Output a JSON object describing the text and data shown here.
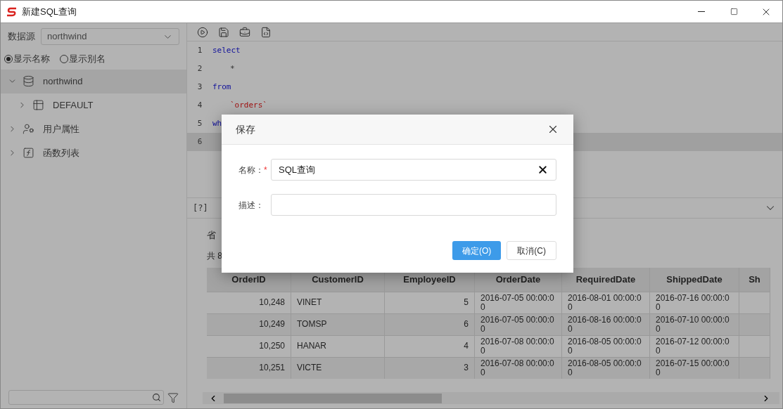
{
  "window": {
    "title": "新建SQL查询"
  },
  "sidebar": {
    "datasource_label": "数据源",
    "datasource_value": "northwind",
    "display_options": [
      {
        "label": "显示名称",
        "selected": true
      },
      {
        "label": "显示别名",
        "selected": false
      }
    ],
    "tree": [
      {
        "label": "northwind",
        "kind": "database",
        "expanded": true,
        "selected": true,
        "children": [
          {
            "label": "DEFAULT",
            "kind": "schema",
            "expanded": false,
            "selected": false
          }
        ]
      },
      {
        "label": "用户属性",
        "kind": "user",
        "expanded": false,
        "selected": false
      },
      {
        "label": "函数列表",
        "kind": "function",
        "expanded": false,
        "selected": false
      }
    ]
  },
  "editor": {
    "lines": [
      {
        "number": "1",
        "active": false,
        "tokens": [
          {
            "text": "select",
            "kind": "keyword"
          }
        ]
      },
      {
        "number": "2",
        "active": false,
        "indent": true,
        "tokens": [
          {
            "text": "*",
            "kind": "plain"
          }
        ]
      },
      {
        "number": "3",
        "active": false,
        "tokens": [
          {
            "text": "from",
            "kind": "keyword"
          }
        ]
      },
      {
        "number": "4",
        "active": false,
        "indent": true,
        "tokens": [
          {
            "text": "`orders`",
            "kind": "string"
          }
        ]
      },
      {
        "number": "5",
        "active": false,
        "tokens": [
          {
            "text": "wh",
            "kind": "keyword"
          }
        ]
      },
      {
        "number": "6",
        "active": true
      }
    ]
  },
  "results": {
    "help_tab": "[?]",
    "caption": "省",
    "count": "共 8",
    "table": {
      "columns": [
        {
          "label": "OrderID",
          "kind": "number"
        },
        {
          "label": "CustomerID",
          "kind": "text"
        },
        {
          "label": "EmployeeID",
          "kind": "number"
        },
        {
          "label": "OrderDate",
          "kind": "text"
        },
        {
          "label": "RequiredDate",
          "kind": "text"
        },
        {
          "label": "ShippedDate",
          "kind": "text"
        },
        {
          "label": "Sh",
          "kind": "text"
        }
      ],
      "rows": [
        [
          "10,248",
          "VINET",
          "5",
          "2016-07-05 00:00:00",
          "2016-08-01 00:00:00",
          "2016-07-16 00:00:00"
        ],
        [
          "10,249",
          "TOMSP",
          "6",
          "2016-07-05 00:00:00",
          "2016-08-16 00:00:00",
          "2016-07-10 00:00:00"
        ],
        [
          "10,250",
          "HANAR",
          "4",
          "2016-07-08 00:00:00",
          "2016-08-05 00:00:00",
          "2016-07-12 00:00:00"
        ],
        [
          "10,251",
          "VICTE",
          "3",
          "2016-07-08 00:00:00",
          "2016-08-05 00:00:00",
          "2016-07-15 00:00:00"
        ]
      ]
    }
  },
  "dialog": {
    "title": "保存",
    "fields": [
      {
        "label": "名称：",
        "required": true,
        "value": "SQL查询"
      },
      {
        "label": "描述：",
        "required": false
      }
    ],
    "buttons": [
      {
        "label": "确定(O)",
        "primary": true
      },
      {
        "label": "取消(C)",
        "primary": false
      }
    ]
  }
}
